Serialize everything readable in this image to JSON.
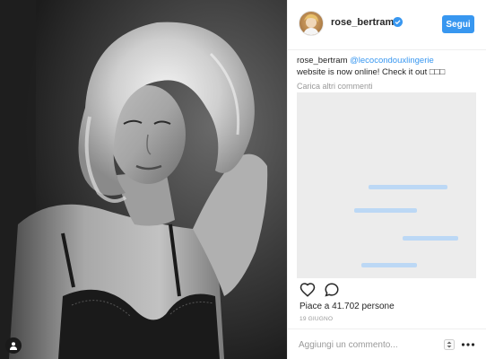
{
  "post": {
    "username": "rose_bertram",
    "follow_label": "Segui",
    "caption": {
      "user": "rose_bertram",
      "mention": "@lecocondouxlingerie",
      "text": "website is now online! Check it out □□□"
    },
    "load_more_label": "Carica altri commenti",
    "likes_label": "Piace a 41.702 persone",
    "date_label": "19 GIUGNO",
    "comment_placeholder": "Aggiungi un commento..."
  },
  "colors": {
    "accent": "#3897f0",
    "muted_text": "#999999",
    "primary_text": "#262626",
    "border": "#efefef",
    "blurred_area": "#ececec"
  },
  "icons": {
    "verified": "verified-badge-icon",
    "like": "heart-outline-icon",
    "comment": "comment-bubble-icon",
    "sort": "sort-arrows-icon",
    "options": "more-options-icon",
    "user_tag": "user-tag-icon"
  }
}
